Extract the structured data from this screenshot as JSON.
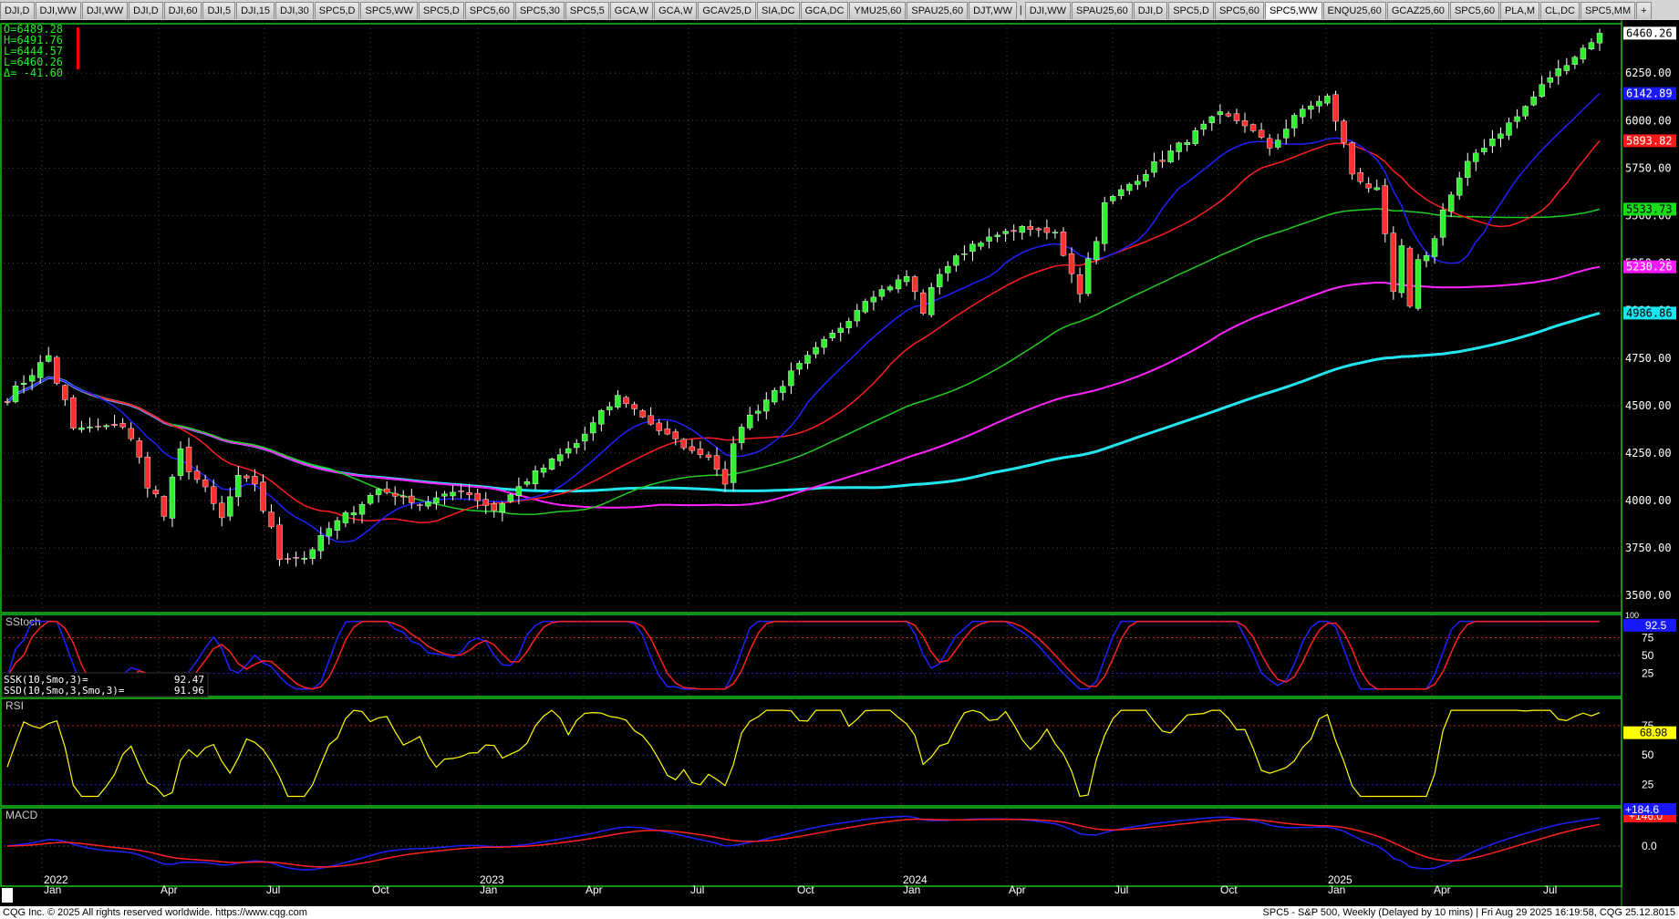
{
  "tabs": [
    "DJI,D",
    "DJI,WW",
    "DJI,WW",
    "DJI,D",
    "DJI,60",
    "DJI,5",
    "DJI,15",
    "DJI,30",
    "SPC5,D",
    "SPC5,WW",
    "SPC5,D",
    "SPC5,60",
    "SPC5,30",
    "SPC5,5",
    "GCA,W",
    "GCA,W",
    "GCAV25,D",
    "SIA,DC",
    "GCA,DC",
    "YMU25,60",
    "SPAU25,60",
    "DJT,WW",
    "|",
    "DJI,WW",
    "SPAU25,60",
    "DJI,D",
    "SPC5,D",
    "SPC5,60",
    "SPC5,WW",
    "ENQU25,60",
    "GCAZ25,60",
    "SPC5,60",
    "PLA,M",
    "CL,DC",
    "SPC5,MM",
    "+"
  ],
  "active_tab_index": 28,
  "status_left": "CQG Inc. © 2025 All rights reserved worldwide. https://www.cqg.com",
  "status_right": "SPC5 - S&P 500, Weekly (Delayed by 10 mins) | Fri Aug 29 2025 16:19:58, CQG 25.12.8015",
  "colors": {
    "bull": "#2ef02e",
    "bear": "#ff3030",
    "ma10": "#2020ff",
    "ma20": "#ff1e1e",
    "ma40": "#22cc22",
    "ma60": "#ff22ff",
    "ma100": "#22e5ee",
    "grid": "#4a4a4a",
    "panel_border": "#19c319",
    "stoch_k": "#2020ff",
    "stoch_d": "#ff2020",
    "rsi": "#ffff00",
    "macd": "#2020ff",
    "macd_signal": "#ff2020"
  },
  "chart_data": {
    "type": "candlestick",
    "symbol": "SPC5",
    "timeframe": "Weekly",
    "ohlc_readout": [
      "O=6489.28",
      "H=6491.76",
      "L=6444.57",
      "L=6460.26",
      "Δ= -41.60"
    ],
    "price_axis": {
      "ticks": [
        3500,
        3750,
        4000,
        4250,
        4500,
        4750,
        5000,
        5250,
        5500,
        5750,
        6000,
        6250
      ],
      "labels": [
        "3500.00",
        "3750.00",
        "4000.00",
        "4250.00",
        "4500.00",
        "4750.00",
        "5000.00",
        "5250.00",
        "5500.00",
        "5750.00",
        "6000.00",
        "6250.00"
      ],
      "range": [
        3410,
        6510
      ]
    },
    "time_axis": {
      "labels": [
        "2022",
        "Jan",
        "Apr",
        "Jul",
        "Oct",
        "2023",
        "Jan",
        "Apr",
        "Jul",
        "Oct",
        "2024",
        "Jan",
        "Apr",
        "Jul",
        "Oct",
        "2025",
        "Jan",
        "Apr",
        "Jul"
      ]
    },
    "price_tags": [
      {
        "value": 6460.26,
        "label": "6460.26",
        "color": "#ffffff",
        "text": "#000000"
      },
      {
        "value": 6142.89,
        "label": "6142.89",
        "color": "#1818ff",
        "text": "#ffffff"
      },
      {
        "value": 5893.82,
        "label": "5893.82",
        "color": "#ff1818",
        "text": "#ffffff"
      },
      {
        "value": 5533.73,
        "label": "5533.73",
        "color": "#18dd18",
        "text": "#000000"
      },
      {
        "value": 5230.26,
        "label": "5230.26",
        "color": "#ff18ff",
        "text": "#ffffff"
      },
      {
        "value": 4986.86,
        "label": "4986.86",
        "color": "#18e5ee",
        "text": "#000000"
      }
    ],
    "anchors": [
      [
        0,
        4540
      ],
      [
        5,
        4760
      ],
      [
        8,
        4380
      ],
      [
        14,
        4400
      ],
      [
        19,
        3920
      ],
      [
        21,
        4250
      ],
      [
        26,
        3900
      ],
      [
        28,
        4130
      ],
      [
        30,
        4100
      ],
      [
        33,
        3690
      ],
      [
        36,
        3700
      ],
      [
        39,
        3850
      ],
      [
        45,
        4060
      ],
      [
        50,
        3980
      ],
      [
        55,
        4060
      ],
      [
        59,
        3950
      ],
      [
        63,
        4110
      ],
      [
        69,
        4300
      ],
      [
        74,
        4550
      ],
      [
        76,
        4480
      ],
      [
        79,
        4370
      ],
      [
        83,
        4260
      ],
      [
        85,
        4230
      ],
      [
        87,
        4120
      ],
      [
        89,
        4400
      ],
      [
        94,
        4620
      ],
      [
        100,
        4870
      ],
      [
        104,
        5060
      ],
      [
        109,
        5180
      ],
      [
        111,
        5000
      ],
      [
        113,
        5200
      ],
      [
        117,
        5350
      ],
      [
        123,
        5440
      ],
      [
        127,
        5400
      ],
      [
        130,
        5120
      ],
      [
        133,
        5560
      ],
      [
        137,
        5700
      ],
      [
        143,
        5900
      ],
      [
        147,
        6040
      ],
      [
        150,
        5980
      ],
      [
        153,
        5860
      ],
      [
        157,
        6060
      ],
      [
        160,
        6120
      ],
      [
        161,
        6010
      ],
      [
        163,
        5720
      ],
      [
        165,
        5650
      ],
      [
        166,
        5580
      ],
      [
        168,
        5090
      ],
      [
        169,
        5300
      ],
      [
        170,
        4980
      ],
      [
        171,
        5270
      ],
      [
        172,
        5280
      ],
      [
        174,
        5530
      ],
      [
        178,
        5830
      ],
      [
        183,
        6020
      ],
      [
        187,
        6230
      ],
      [
        190,
        6340
      ],
      [
        193,
        6460
      ]
    ],
    "ma_tags": {
      "ma10": 6142.89,
      "ma20": 5893.82,
      "ma40": 5533.73,
      "ma60": 5230.26,
      "ma100": 4986.86
    },
    "sstoch": {
      "label": "SStoch",
      "ssk_label": "SSK(10,Smo,3)=",
      "ssk_value": "92.47",
      "ssd_label": "SSD(10,Smo,3,Smo,3)=",
      "ssd_value": "91.96",
      "ticks": [
        25,
        50,
        75
      ],
      "tag": "92.5",
      "top_tick": "100"
    },
    "rsi": {
      "label": "RSI",
      "ticks": [
        25,
        50,
        75
      ],
      "tag": "68.98"
    },
    "macd": {
      "label": "MACD",
      "ticks": [
        "0.0"
      ],
      "tag": "+184.6",
      "tag2": "+146.0"
    }
  }
}
